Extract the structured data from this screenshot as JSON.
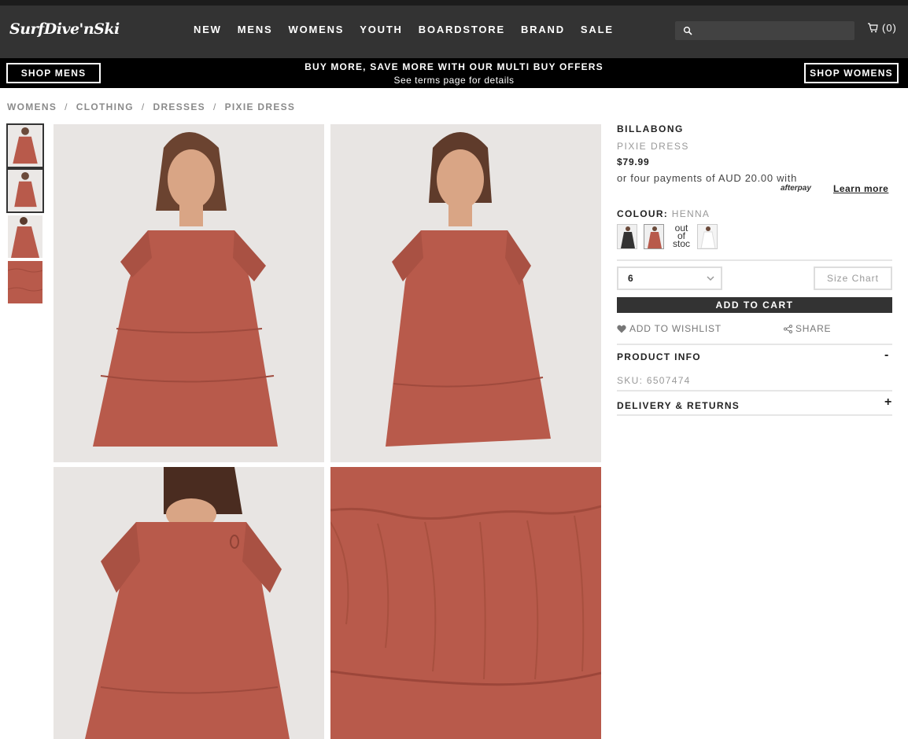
{
  "header": {
    "logo_text": "SurfDive'nSki",
    "nav": [
      "NEW",
      "MENS",
      "WOMENS",
      "YOUTH",
      "BOARDSTORE",
      "BRAND",
      "SALE"
    ],
    "search_placeholder": "",
    "cart_count": "(0)"
  },
  "promo": {
    "left_button": "SHOP MENS",
    "right_button": "SHOP WOMENS",
    "title": "BUY MORE, SAVE MORE WITH OUR MULTI BUY OFFERS",
    "subtitle": "See terms page for details"
  },
  "breadcrumb": [
    "WOMENS",
    "CLOTHING",
    "DRESSES",
    "PIXIE DRESS"
  ],
  "product": {
    "brand": "BILLABONG",
    "name": "PIXIE DRESS",
    "price": "$79.99",
    "installments": "or four payments of AUD 20.00 with",
    "afterpay_logo": "afterpay",
    "learn_more": "Learn more",
    "colour_label": "COLOUR:",
    "colour_value": "HENNA",
    "out_of_stock_label": "out of stoc",
    "size_selected": "6",
    "size_chart": "Size Chart",
    "add_to_cart": "ADD TO CART",
    "add_to_wishlist": "ADD TO WISHLIST",
    "share": "SHARE",
    "product_info_title": "PRODUCT INFO",
    "product_info_toggle": "-",
    "sku": "SKU: 6507474",
    "delivery_title": "DELIVERY & RETURNS",
    "delivery_toggle": "+"
  },
  "colors": {
    "header_bg": "#333333",
    "promo_bg": "#000000",
    "dress": "#b85a4b"
  }
}
